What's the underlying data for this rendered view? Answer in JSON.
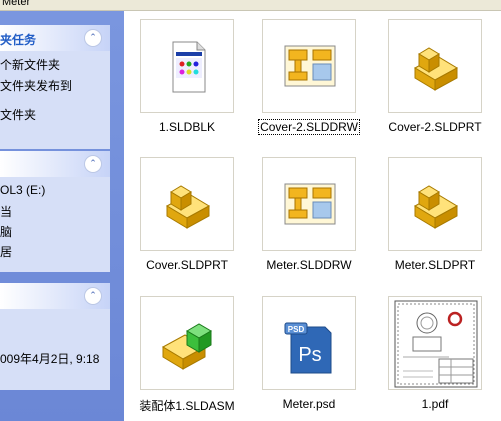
{
  "window": {
    "title": "Meter"
  },
  "tasks_panel": {
    "title": "夹任务",
    "items": [
      "个新文件夹",
      "文件夹发布到",
      "文件夹"
    ]
  },
  "places_panel": {
    "items": [
      "OL3 (E:)",
      "当",
      "脑",
      "居"
    ]
  },
  "details_panel": {
    "date": "009年4月2日, 9:18"
  },
  "files": [
    {
      "name": "1.SLDBLK",
      "icon": "sldblk-icon"
    },
    {
      "name": "Cover-2.SLDDRW",
      "icon": "slddrw-icon",
      "focused": true
    },
    {
      "name": "Cover-2.SLDPRT",
      "icon": "sldprt-icon"
    },
    {
      "name": "Cover.SLDPRT",
      "icon": "sldprt-icon"
    },
    {
      "name": "Meter.SLDDRW",
      "icon": "slddrw-icon"
    },
    {
      "name": "Meter.SLDPRT",
      "icon": "sldprt-icon"
    },
    {
      "name": "装配体1.SLDASM",
      "icon": "sldasm-icon"
    },
    {
      "name": "Meter.psd",
      "icon": "psd-icon",
      "badge": "PSD",
      "label": "Ps"
    },
    {
      "name": "1.pdf",
      "icon": "pdf-thumbnail"
    }
  ]
}
